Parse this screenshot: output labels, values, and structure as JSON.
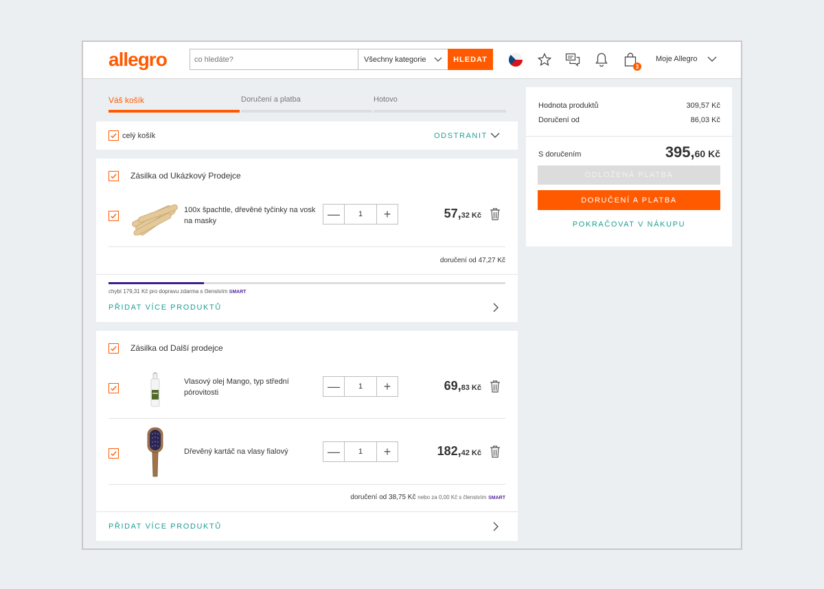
{
  "header": {
    "logo": "allegro",
    "search_placeholder": "co hledáte?",
    "category": "Všechny kategorie",
    "search_button": "HLEDAT",
    "cart_count": "3",
    "account": "Moje Allegro"
  },
  "steps": [
    {
      "label": "Váš košík",
      "active": true
    },
    {
      "label": "Doručení a platba",
      "active": false
    },
    {
      "label": "Hotovo",
      "active": false
    }
  ],
  "cart_header": {
    "select_all": "celý košík",
    "remove": "ODSTRANIT"
  },
  "shipments": [
    {
      "seller": "Zásilka od Ukázkový Prodejce",
      "items": [
        {
          "name_line1": "100x špachtle, dřevěné tyčinky na vosk",
          "name_line2": "na masky",
          "qty": "1",
          "price_int": "57,",
          "price_dec": "32 Kč",
          "image": "wooden-sticks"
        }
      ],
      "delivery": "doručení od 47,27 Kč",
      "smart_progress": 0.24,
      "smart_note": "chybí 179,31 Kč pro dopravu zdarma s členstvím",
      "smart_label": "SMART",
      "add_more": "PŘIDAT VÍCE PRODUKTŮ"
    },
    {
      "seller": "Zásilka od Další prodejce",
      "items": [
        {
          "name_line1": "Vlasový olej Mango, typ střední",
          "name_line2": "pórovitosti",
          "qty": "1",
          "price_int": "69,",
          "price_dec": "83 Kč",
          "image": "oil-bottle"
        },
        {
          "name_line1": "Dřevěný kartáč na vlasy fialový",
          "name_line2": "",
          "qty": "1",
          "price_int": "182,",
          "price_dec": "42 Kč",
          "image": "hair-brush"
        }
      ],
      "delivery_main": "doručení od 38,75 Kč",
      "delivery_note": "nebo za 0,00 Kč s členstvím",
      "smart_label": "SMART",
      "add_more": "PŘIDAT VÍCE PRODUKTŮ"
    }
  ],
  "summary": {
    "products_label": "Hodnota produktů",
    "products_value": "309,57 Kč",
    "delivery_label": "Doručení od",
    "delivery_value": "86,03 Kč",
    "total_label": "S doručením",
    "total_int": "395,",
    "total_dec": "60 Kč",
    "deferred_button": "ODLOŽENÁ PLATBA",
    "checkout_button": "DORUČENÍ A PLATBA",
    "continue_link": "POKRAČOVAT V NÁKUPU"
  },
  "colors": {
    "brand": "#ff5a00",
    "teal": "#1c9e94",
    "smart": "#5a2ca0"
  }
}
